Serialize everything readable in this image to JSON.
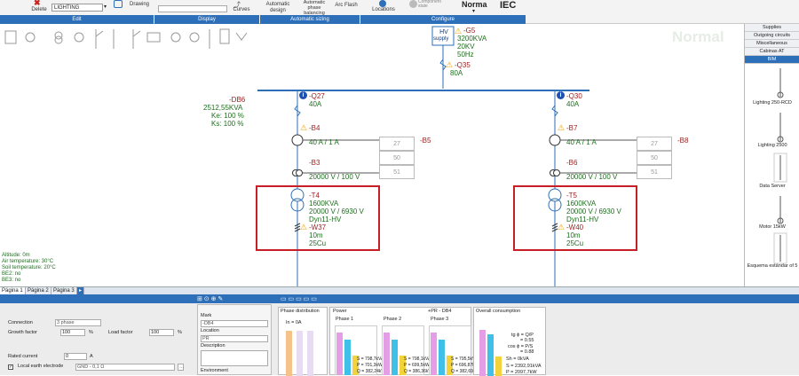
{
  "ribbon": {
    "delete": "Delete",
    "search_value": "LIGHTING",
    "drawing": "Drawing",
    "curves": "Curves",
    "auto_design": "Automatic design",
    "auto_phase": "Automatic phase balancing",
    "arc_flash": "Arc Flash",
    "locations": "Locations",
    "component_state": "Component state",
    "norma": "Norma",
    "iec": "IEC",
    "groups": [
      "Edit",
      "Display",
      "Automatic sizing",
      "Configure"
    ]
  },
  "canvas": {
    "watermark": "Normal",
    "hv": {
      "label1": "HV",
      "label2": "supply"
    },
    "g5": {
      "id": "-G5",
      "power": "3200KVA",
      "voltage": "20KV",
      "freq": "50Hz"
    },
    "q35": {
      "id": "-Q35",
      "current": "80A"
    },
    "db6": {
      "id": "-DB6",
      "power": "2512,55KVA",
      "ke": "Ke: 100 %",
      "ks": "Ks: 100 %"
    },
    "left": {
      "q": "-Q27",
      "q_current": "40A",
      "b4": "-B4",
      "b4_ratio": "40 A / 1 A",
      "b5": "-B5",
      "b3": "-B3",
      "b3_ratio": "20000 V / 100 V",
      "t": "-T4",
      "t_power": "1600KVA",
      "t_ratio": "20000 V / 6930 V",
      "t_vec": "Dyn11-HV",
      "w": "-W37",
      "w_len": "10m",
      "w_sec": "25Cu",
      "box": [
        "27",
        "50",
        "51"
      ]
    },
    "right": {
      "q": "-Q30",
      "q_current": "40A",
      "b4": "-B7",
      "b4_ratio": "40 A / 1 A",
      "b5": "-B8",
      "b3": "-B6",
      "b3_ratio": "20000 V / 100 V",
      "t": "-T5",
      "t_power": "1600KVA",
      "t_ratio": "20000 V / 6930 V",
      "t_vec": "Dyn11-HV",
      "w": "-W40",
      "w_len": "10m",
      "w_sec": "25Cu",
      "box": [
        "27",
        "50",
        "51"
      ]
    },
    "env": [
      "Altitude: 0m",
      "Air temperature: 30°C",
      "Soil temperature: 20°C",
      "BE2: no",
      "BE3: no"
    ]
  },
  "right_panel": {
    "tabs": [
      "Supplies",
      "Outgoing circuits",
      "Miscellaneous",
      "Cabinas AT",
      "BIM"
    ],
    "selected": "BIM",
    "items": [
      "Lighting 250-RCD",
      "Lighting 2500",
      "Data Server",
      "Motor 15kW",
      "Esquema estándar of 5"
    ]
  },
  "page_tabs": [
    "Página 1",
    "Página 2",
    "Página 3"
  ],
  "bottom": {
    "connection": "Connection",
    "connection_val": "3 phase",
    "growth": "Growth factor",
    "growth_val": "100",
    "load": "Load factor",
    "load_val": "100",
    "pct": "%",
    "rated": "Rated current",
    "rated_val": "0",
    "amp": "A",
    "earth": "Local earth electrode",
    "earth_val": "GND - 0,1 Ω",
    "mark": "Mark",
    "mark_val": "-DB4",
    "location": "Location",
    "location_val": "PR",
    "description": "Description",
    "environment": "Environment",
    "phase_dist": "Phase distribution",
    "in_val": "In = 0A",
    "power": "Power",
    "pr_db4": "+PR - DB4",
    "overall": "Overall consumption",
    "phase1": "Phase 1",
    "phase2": "Phase 2",
    "phase3": "Phase 3",
    "p1": [
      "S = 798,7kVA",
      "P = 701,3kW",
      "Q = 382,24kVAR"
    ],
    "p2": [
      "S = 798,1kVA",
      "P = 699,5kW",
      "Q = 386,36kVAR"
    ],
    "p3": [
      "S = 795,5kVA",
      "P = 696,87kW",
      "Q = 382,69kVAR"
    ],
    "ov": [
      "tg ϕ = Q/P",
      "= 0.55",
      "cos ϕ = P/S",
      "= 0.88",
      "Sh = 0kVA",
      "S = 2392,91kVA",
      "P = 2097,7kW"
    ]
  }
}
